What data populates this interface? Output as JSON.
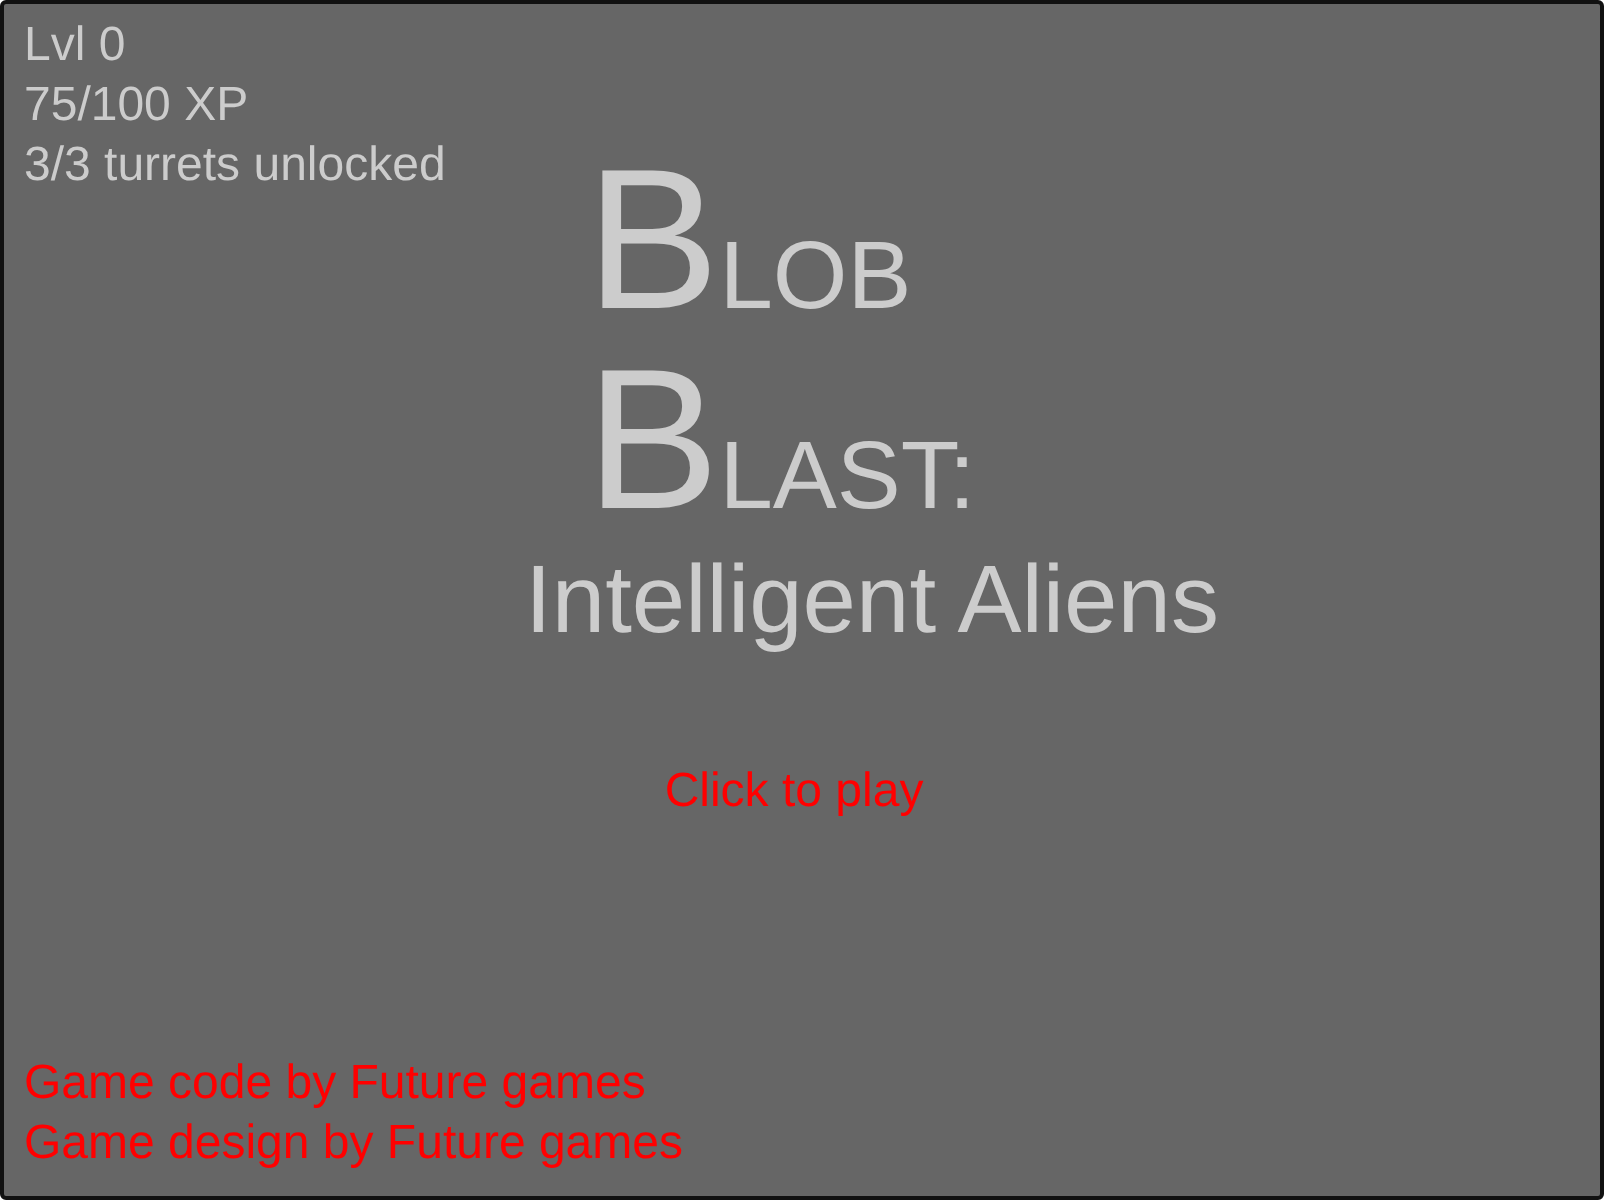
{
  "stats": [
    "Lvl 0",
    "75/100 XP",
    "3/3 turrets unlocked"
  ],
  "title_lines": [
    {
      "initial": "B",
      "rest": "LOB"
    },
    {
      "initial": "B",
      "rest": "LAST:"
    }
  ],
  "subtitle": "Intelligent Aliens",
  "play_prompt": "Click to play",
  "credits": [
    "Game code by Future games",
    "Game design by Future games"
  ]
}
